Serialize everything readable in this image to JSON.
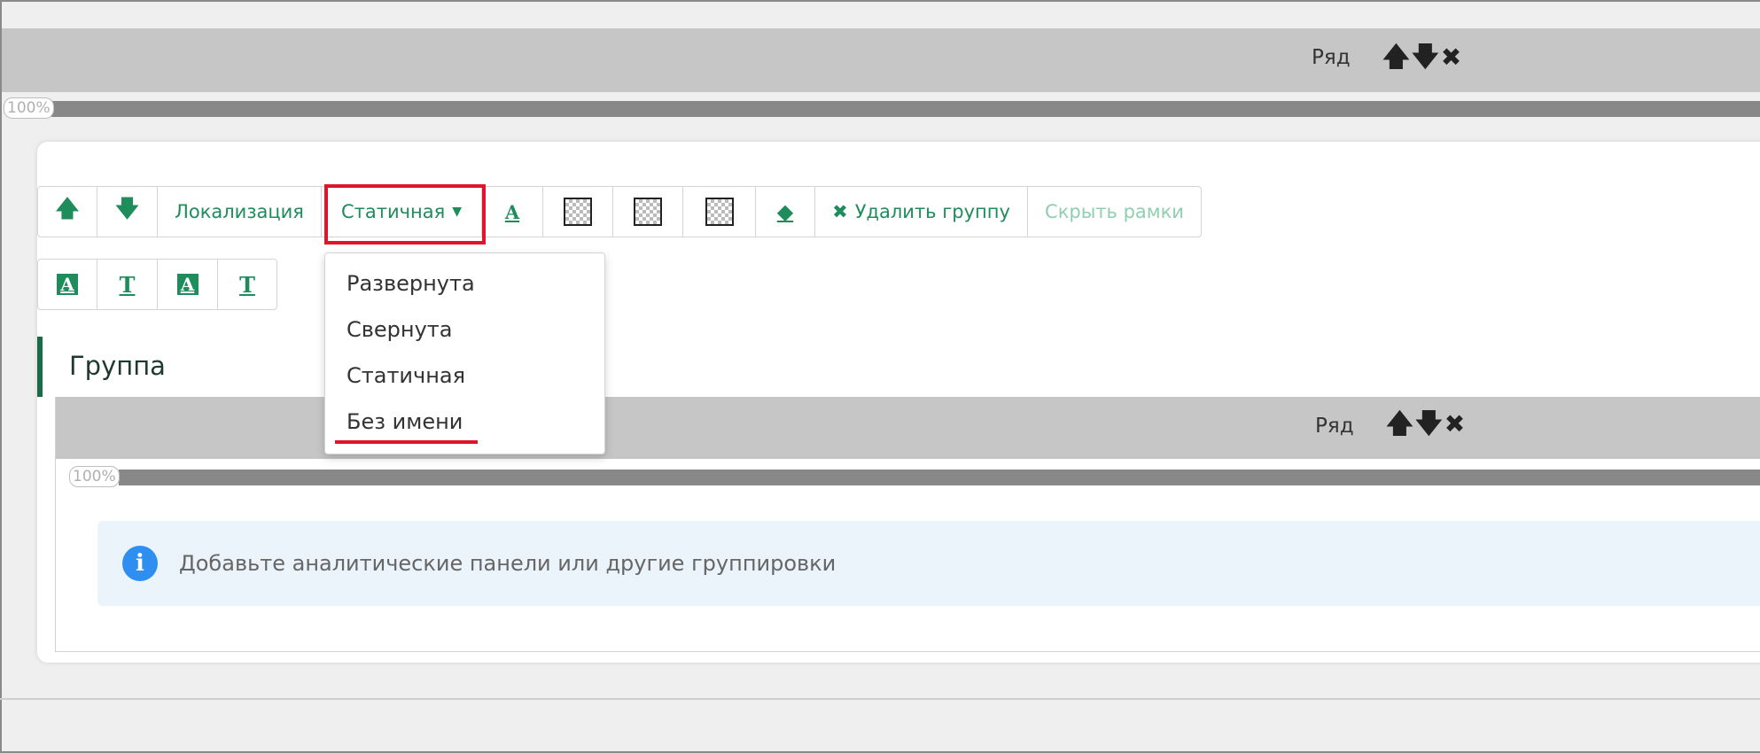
{
  "top_row": {
    "label": "Ряд",
    "percent": "100%"
  },
  "toolbar": {
    "move_up": "🡅",
    "move_down": "🡇",
    "localization": "Локализация",
    "mode_select": "Статичная",
    "font_color_glyph": "A",
    "delete_group": "Удалить группу",
    "hide_frames": "Скрыть рамки"
  },
  "text_style_buttons": [
    "A",
    "T",
    "A",
    "T"
  ],
  "dropdown": {
    "options": [
      "Развернута",
      "Свернута",
      "Статичная",
      "Без имени"
    ]
  },
  "group": {
    "title": "Группа",
    "row_label": "Ряд",
    "percent": "100%",
    "info_text": "Добавьте аналитические панели или другие группировки"
  },
  "colors": {
    "accent": "#1f8c5c",
    "highlight_red": "#e0152b",
    "info_blue": "#2e8ff0"
  },
  "icons": [
    "arrow-up-icon",
    "arrow-down-icon",
    "close-icon",
    "caret-down-icon",
    "font-color-icon",
    "checker-pattern-icon",
    "eraser-icon",
    "info-icon"
  ]
}
